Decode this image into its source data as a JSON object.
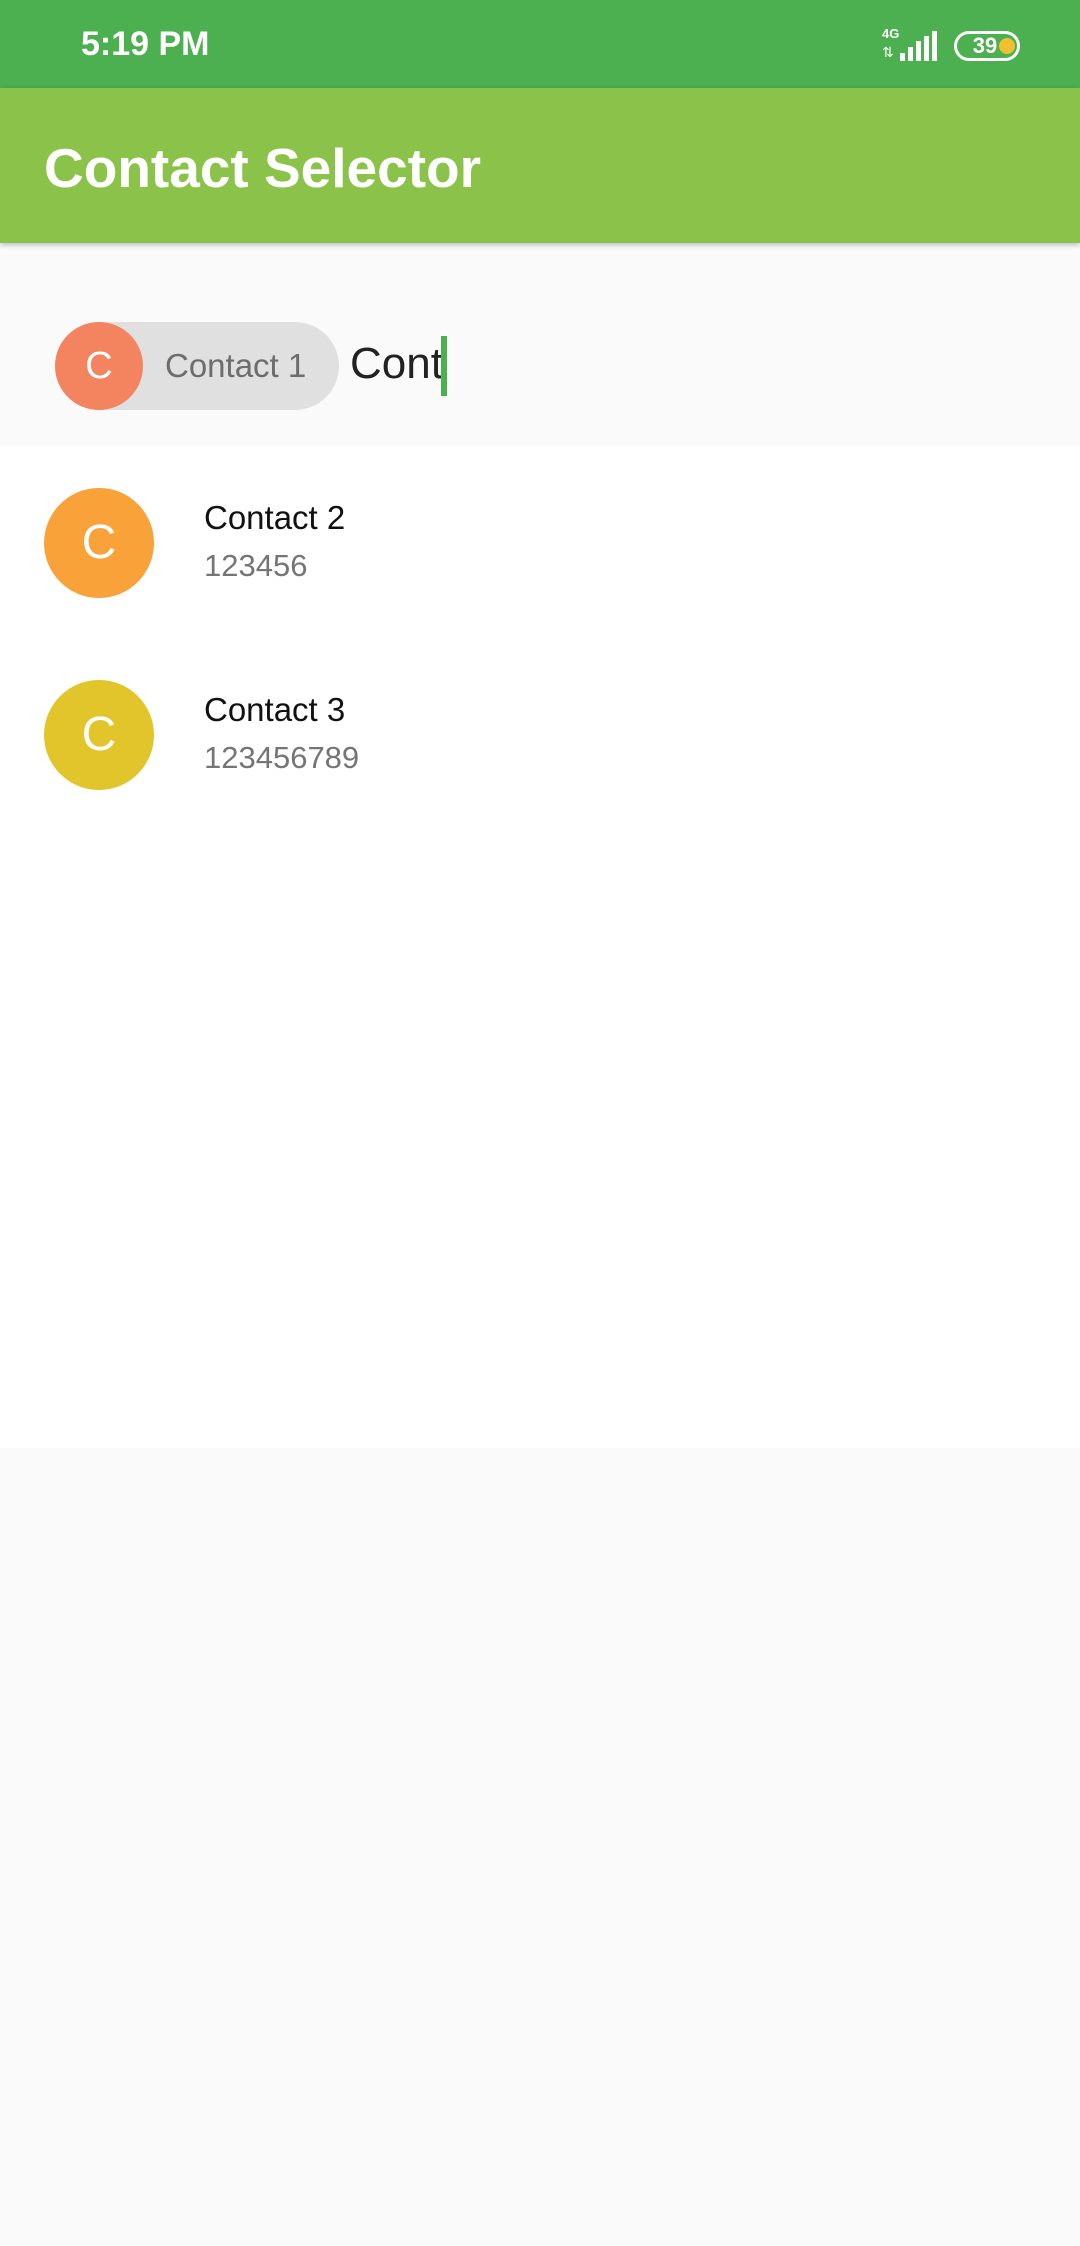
{
  "status_bar": {
    "time": "5:19 PM",
    "network": "4G",
    "network_arrows": "⇅",
    "battery": "39",
    "battery_color": "#f0c030"
  },
  "app_bar": {
    "title": "Contact Selector",
    "color": "#8bc34a"
  },
  "selector": {
    "chip": {
      "initial": "C",
      "label": "Contact 1",
      "color": "#f4845f"
    },
    "input_value": "Cont",
    "cursor_color": "#4caf50"
  },
  "contacts": [
    {
      "initial": "C",
      "name": "Contact 2",
      "phone": "123456",
      "color": "#f9a23a"
    },
    {
      "initial": "C",
      "name": "Contact 3",
      "phone": "123456789",
      "color": "#e2c52b"
    }
  ]
}
